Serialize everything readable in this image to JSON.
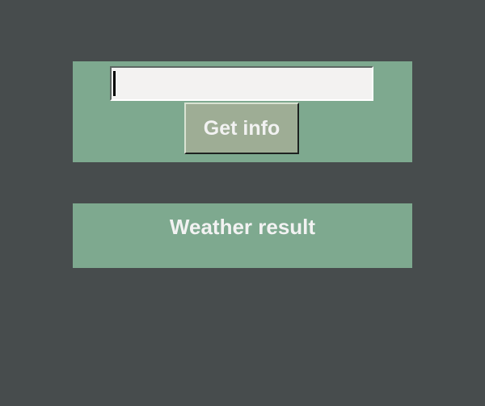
{
  "colors": {
    "window_background": "#474c4d",
    "frame_background": "#7ea98f",
    "entry_background": "#f3f2f1",
    "button_background": "#9ead95",
    "text": "#f2f2f2"
  },
  "search": {
    "value": "",
    "button_label": "Get info"
  },
  "result": {
    "label": "Weather result"
  }
}
